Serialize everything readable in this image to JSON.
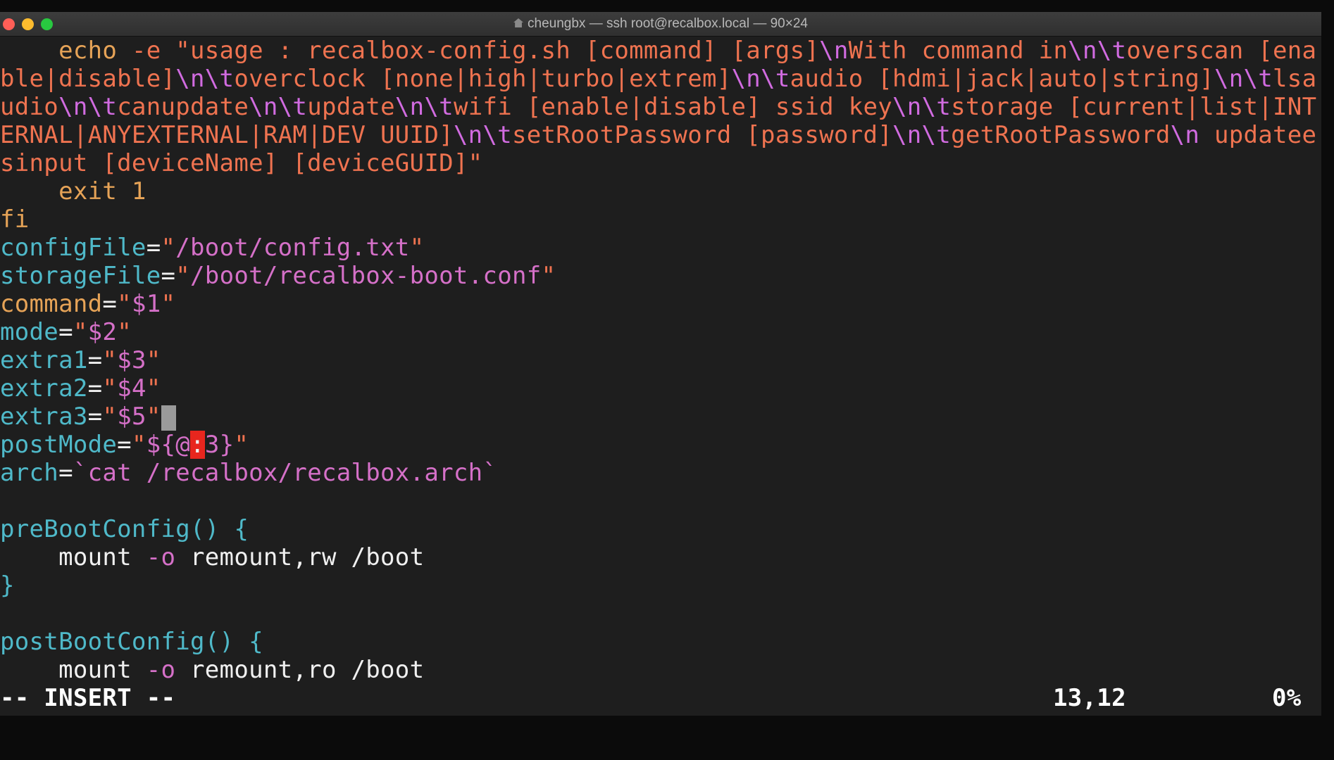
{
  "window": {
    "title": "cheungbx — ssh root@recalbox.local — 90×24",
    "traffic_lights": [
      "#ff5f57",
      "#febc2e",
      "#28c840"
    ]
  },
  "editor": {
    "lines": [
      [
        [
          "    echo ",
          "kw"
        ],
        [
          "-e \"usage : recalbox-config.sh [command] [args]",
          "str"
        ],
        [
          "\\n",
          "esc"
        ],
        [
          "With command in",
          "str"
        ],
        [
          "\\n\\t",
          "esc"
        ],
        [
          "overscan [ena",
          "str"
        ]
      ],
      [
        [
          "ble|disable]",
          "str"
        ],
        [
          "\\n\\t",
          "esc"
        ],
        [
          "overclock [none|high|turbo|extrem]",
          "str"
        ],
        [
          "\\n\\t",
          "esc"
        ],
        [
          "audio [hdmi|jack|auto|string]",
          "str"
        ],
        [
          "\\n\\t",
          "esc"
        ],
        [
          "lsa",
          "str"
        ]
      ],
      [
        [
          "udio",
          "str"
        ],
        [
          "\\n\\t",
          "esc"
        ],
        [
          "canupdate",
          "str"
        ],
        [
          "\\n\\t",
          "esc"
        ],
        [
          "update",
          "str"
        ],
        [
          "\\n\\t",
          "esc"
        ],
        [
          "wifi [enable|disable] ssid key",
          "str"
        ],
        [
          "\\n\\t",
          "esc"
        ],
        [
          "storage [current|list|INT",
          "str"
        ]
      ],
      [
        [
          "ERNAL|ANYEXTERNAL|RAM|DEV UUID]",
          "str"
        ],
        [
          "\\n\\t",
          "esc"
        ],
        [
          "setRootPassword [password]",
          "str"
        ],
        [
          "\\n\\t",
          "esc"
        ],
        [
          "getRootPassword",
          "str"
        ],
        [
          "\\n",
          "esc"
        ],
        [
          " updatee",
          "str"
        ]
      ],
      [
        [
          "sinput [deviceName] [deviceGUID]\"",
          "str"
        ]
      ],
      [
        [
          "    exit 1",
          "kw"
        ]
      ],
      [
        [
          "fi",
          "kw"
        ]
      ],
      [
        [
          "configFile",
          "var"
        ],
        [
          "=",
          "op"
        ],
        [
          "\"",
          "str"
        ],
        [
          "/boot/config.txt",
          "mag"
        ],
        [
          "\"",
          "str"
        ]
      ],
      [
        [
          "storageFile",
          "var"
        ],
        [
          "=",
          "op"
        ],
        [
          "\"",
          "str"
        ],
        [
          "/boot/recalbox-boot.conf",
          "mag"
        ],
        [
          "\"",
          "str"
        ]
      ],
      [
        [
          "command",
          "kw"
        ],
        [
          "=",
          "op"
        ],
        [
          "\"",
          "str"
        ],
        [
          "$1",
          "mag"
        ],
        [
          "\"",
          "str"
        ]
      ],
      [
        [
          "mode",
          "var"
        ],
        [
          "=",
          "op"
        ],
        [
          "\"",
          "str"
        ],
        [
          "$2",
          "mag"
        ],
        [
          "\"",
          "str"
        ]
      ],
      [
        [
          "extra1",
          "var"
        ],
        [
          "=",
          "op"
        ],
        [
          "\"",
          "str"
        ],
        [
          "$3",
          "mag"
        ],
        [
          "\"",
          "str"
        ]
      ],
      [
        [
          "extra2",
          "var"
        ],
        [
          "=",
          "op"
        ],
        [
          "\"",
          "str"
        ],
        [
          "$4",
          "mag"
        ],
        [
          "\"",
          "str"
        ]
      ],
      [
        [
          "extra3",
          "var"
        ],
        [
          "=",
          "op"
        ],
        [
          "\"",
          "str"
        ],
        [
          "$5",
          "mag"
        ],
        [
          "\"",
          "str"
        ],
        [
          "",
          "cursor"
        ]
      ],
      [
        [
          "postMode",
          "var"
        ],
        [
          "=",
          "op"
        ],
        [
          "\"",
          "str"
        ],
        [
          "${@",
          "mag"
        ],
        [
          ":",
          "err"
        ],
        [
          "3}",
          "mag"
        ],
        [
          "\"",
          "str"
        ]
      ],
      [
        [
          "arch",
          "var"
        ],
        [
          "=",
          "op"
        ],
        [
          "`cat /recalbox/recalbox.arch`",
          "mag"
        ]
      ],
      [],
      [
        [
          "preBootConfig() {",
          "var"
        ]
      ],
      [
        [
          "    mount ",
          "fg"
        ],
        [
          "-o",
          "mag"
        ],
        [
          " remount,rw /boot",
          "fg"
        ]
      ],
      [
        [
          "}",
          "var"
        ]
      ],
      [],
      [
        [
          "postBootConfig() {",
          "var"
        ]
      ],
      [
        [
          "    mount ",
          "fg"
        ],
        [
          "-o",
          "mag"
        ],
        [
          " remount,ro /boot",
          "fg"
        ]
      ]
    ]
  },
  "status": {
    "mode": "-- INSERT --",
    "position": "13,12",
    "percent": "0%"
  }
}
